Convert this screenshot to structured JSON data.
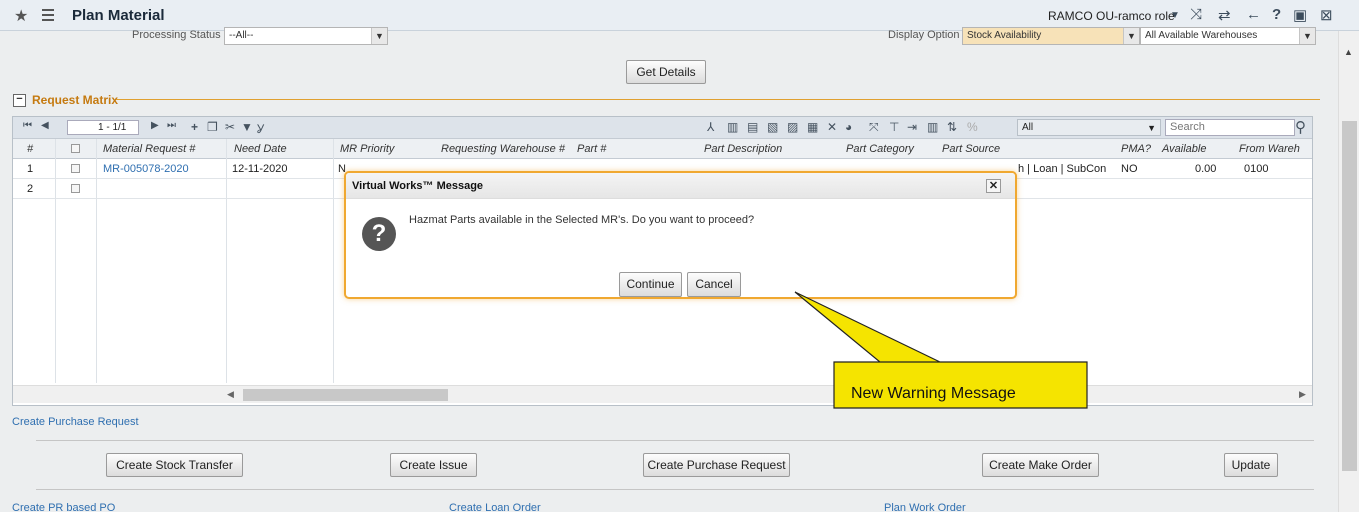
{
  "window": {
    "title": "Plan Material",
    "role": "RAMCO OU-ramco role"
  },
  "filters": {
    "processing_status_label": "Processing Status",
    "processing_status_value": "--All--",
    "display_option_label": "Display Option",
    "display_option_value": "Stock Availability",
    "warehouse_value": "All Available Warehouses",
    "get_details_label": "Get Details"
  },
  "section": {
    "title": "Request Matrix"
  },
  "grid": {
    "page_indicator": "1 - 1/1",
    "filter_all": "All",
    "search_placeholder": "Search",
    "columns": [
      "#",
      "Material Request #",
      "Need Date",
      "MR Priority",
      "Requesting Warehouse #",
      "Part #",
      "Part Description",
      "Part Category",
      "Part Source",
      "PMA?",
      "Available",
      "From Wareh"
    ],
    "rows": [
      {
        "num": "1",
        "mr": "MR-005078-2020",
        "need_date": "12-11-2020",
        "priority": "N",
        "part_source": "h | Loan | SubCon",
        "pma": "NO",
        "available": "0.00",
        "from_wh": "0100"
      },
      {
        "num": "2",
        "mr": "",
        "need_date": "",
        "priority": "",
        "part_source": "",
        "pma": "",
        "available": "",
        "from_wh": ""
      }
    ]
  },
  "links": {
    "create_purchase_request": "Create Purchase Request",
    "create_pr_based_po": "Create PR based PO",
    "create_loan_order": "Create Loan Order",
    "plan_work_order": "Plan Work Order"
  },
  "buttons": {
    "create_stock_transfer": "Create Stock Transfer",
    "create_issue": "Create Issue",
    "create_purchase_request": "Create Purchase Request",
    "create_make_order": "Create Make Order",
    "update": "Update"
  },
  "dialog": {
    "title": "Virtual Works™ Message",
    "message": "Hazmat Parts available in the Selected MR's. Do you want to proceed?",
    "continue_label": "Continue",
    "cancel_label": "Cancel"
  },
  "callout": {
    "text": "New Warning Message",
    "color": "#f5e400"
  }
}
